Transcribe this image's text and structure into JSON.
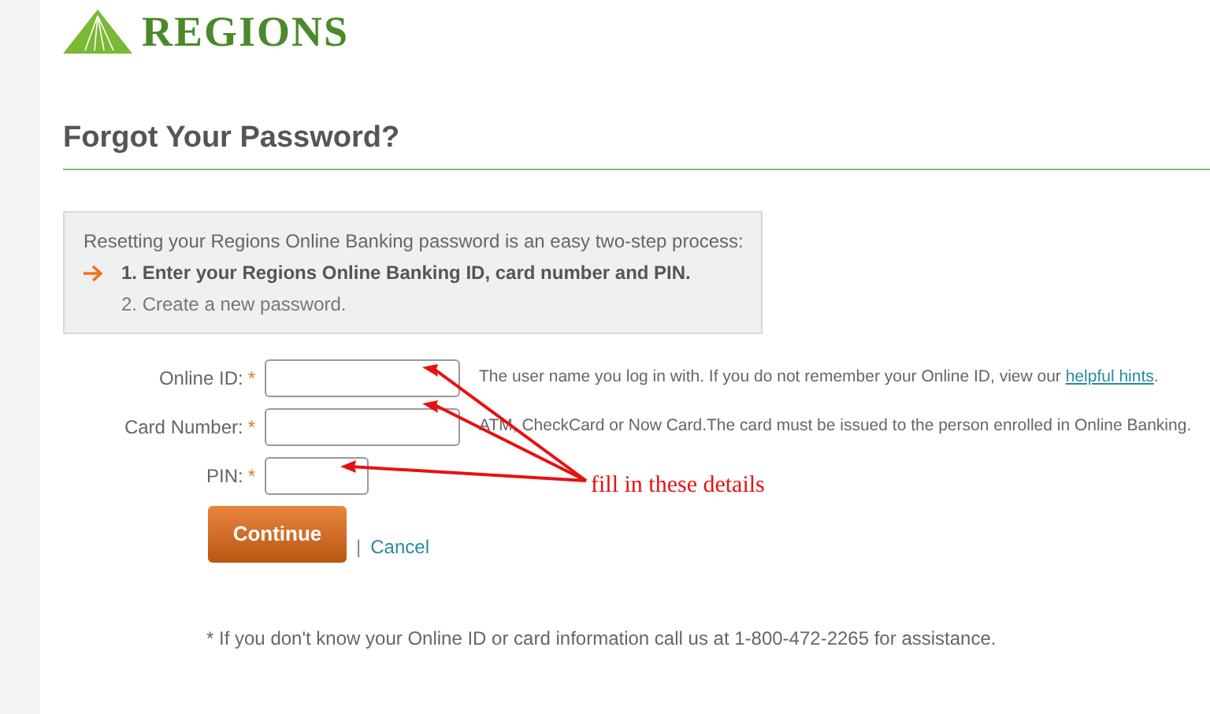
{
  "logo": {
    "text": "REGIONS"
  },
  "heading": "Forgot Your Password?",
  "info_box": {
    "intro": "Resetting your Regions Online Banking password is an easy two-step process:",
    "steps": [
      {
        "text": "1. Enter your Regions Online Banking ID, card number and PIN.",
        "selected": true
      },
      {
        "text": "2. Create a new password.",
        "selected": false
      }
    ]
  },
  "fields": [
    {
      "label": "Online ID:",
      "required_mark": "*",
      "kind": "wide",
      "annotated": true,
      "hint": "The user name you log in with. If you do not remember your Online ID, view our ",
      "hint_link": "helpful hints",
      "hint_end": "."
    },
    {
      "label": "Card Number:",
      "required_mark": "*",
      "kind": "wide",
      "annotated": true,
      "hint": "ATM, CheckCard or Now Card.The card must be issued to the person enrolled in Online Banking."
    },
    {
      "label": "PIN:",
      "required_mark": "*",
      "kind": "narrow",
      "annotated": true
    }
  ],
  "buttons": {
    "continue": "Continue",
    "separator": "|",
    "cancel": "Cancel"
  },
  "footnote": "* If you don't know your Online ID or card information call us at 1-800-472-2265 for assistance.",
  "annotation": {
    "text": "fill in these details"
  }
}
